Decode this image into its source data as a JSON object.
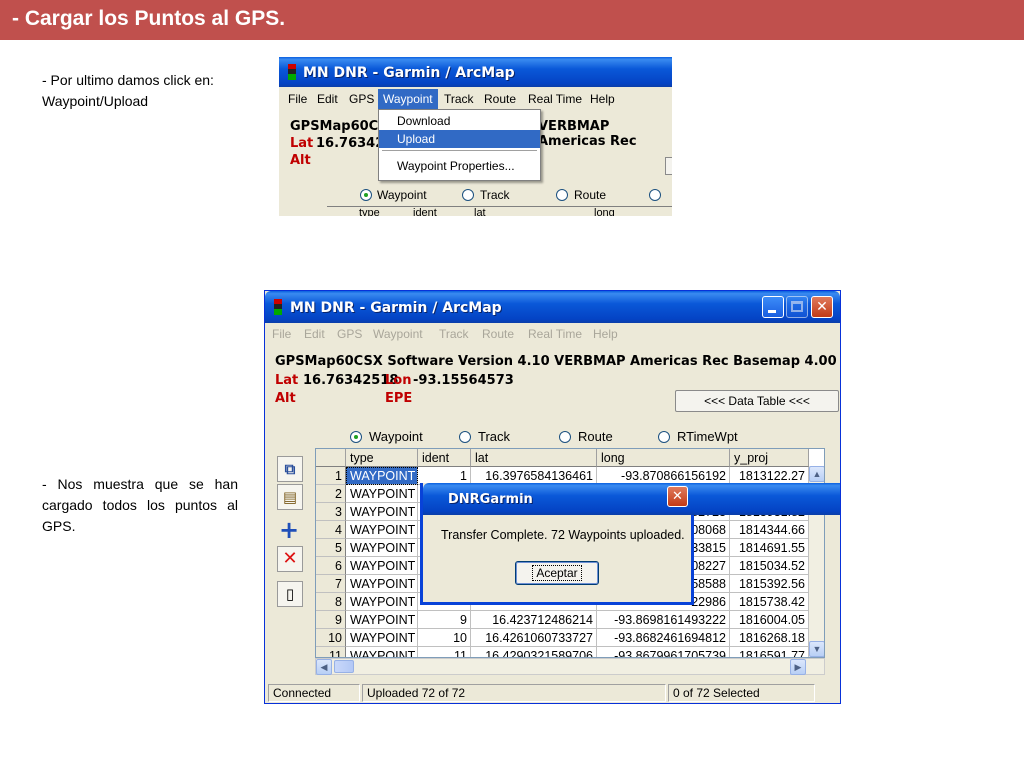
{
  "slide": {
    "title": "- Cargar los Puntos al GPS.",
    "note1": "- Por ultimo damos click en: Waypoint/Upload",
    "note2": "- Nos muestra que se han cargado todos los puntos al GPS."
  },
  "app": {
    "title": "MN DNR - Garmin / ArcMap",
    "menu": [
      "File",
      "Edit",
      "GPS",
      "Waypoint",
      "Track",
      "Route",
      "Real Time",
      "Help"
    ],
    "gps_info": "GPSMap60CSX Software Version 4.10 VERBMAP Americas Rec Basemap 4.00",
    "gps_info_short": "GPSMap60CSX",
    "gps_info_tail": "VERBMAP Americas Rec",
    "lat_label": "Lat",
    "lat_value": "16.76342518",
    "lat_value_short": "16.763425",
    "lon_label": "Lon",
    "lon_value": "-93.15564573",
    "alt_label": "Alt",
    "epe_label": "EPE",
    "data_table_button": "<<< Data Table <<<",
    "radios": [
      "Waypoint",
      "Track",
      "Route",
      "RTimeWpt"
    ],
    "radio_selected": "Waypoint",
    "columns": [
      "type",
      "ident",
      "lat",
      "long",
      "y_proj"
    ],
    "rows": [
      {
        "n": "1",
        "type": "WAYPOINT",
        "ident": "1",
        "lat": "16.3976584136461",
        "long": "-93.870866156192",
        "y_proj": "1813122.27"
      },
      {
        "n": "2",
        "type": "WAYPOINT",
        "ident": "",
        "lat": "",
        "long": "75444",
        "y_proj": "1813562.2"
      },
      {
        "n": "3",
        "type": "WAYPOINT",
        "ident": "",
        "lat": "",
        "long": "82723",
        "y_proj": "1813931.82"
      },
      {
        "n": "4",
        "type": "WAYPOINT",
        "ident": "",
        "lat": "",
        "long": "08068",
        "y_proj": "1814344.66"
      },
      {
        "n": "5",
        "type": "WAYPOINT",
        "ident": "",
        "lat": "",
        "long": "33815",
        "y_proj": "1814691.55"
      },
      {
        "n": "6",
        "type": "WAYPOINT",
        "ident": "",
        "lat": "",
        "long": "08227",
        "y_proj": "1815034.52"
      },
      {
        "n": "7",
        "type": "WAYPOINT",
        "ident": "",
        "lat": "",
        "long": "58588",
        "y_proj": "1815392.56"
      },
      {
        "n": "8",
        "type": "WAYPOINT",
        "ident": "",
        "lat": "",
        "long": "22986",
        "y_proj": "1815738.42"
      },
      {
        "n": "9",
        "type": "WAYPOINT",
        "ident": "9",
        "lat": "16.423712486214",
        "long": "-93.8698161493222",
        "y_proj": "1816004.05"
      },
      {
        "n": "10",
        "type": "WAYPOINT",
        "ident": "10",
        "lat": "16.4261060733727",
        "long": "-93.8682461694812",
        "y_proj": "1816268.18"
      },
      {
        "n": "11",
        "type": "WAYPOINT",
        "ident": "11",
        "lat": "16.4290321589706",
        "long": "-93.8679961705739",
        "y_proj": "1816591.77"
      }
    ],
    "status": {
      "connection": "Connected",
      "uploaded": "Uploaded 72 of 72",
      "selected": "0 of 72 Selected"
    }
  },
  "dropdown": {
    "items": [
      "Download",
      "Upload",
      "Waypoint Properties..."
    ],
    "selected": "Upload"
  },
  "dialog": {
    "title": "DNRGarmin",
    "message": "Transfer Complete. 72 Waypoints uploaded.",
    "ok_label": "Aceptar"
  },
  "colors": {
    "header_bar": "#c0504d",
    "xp_blue": "#0a58d8",
    "selection": "#316ac5",
    "lat_red": "#c00000"
  }
}
